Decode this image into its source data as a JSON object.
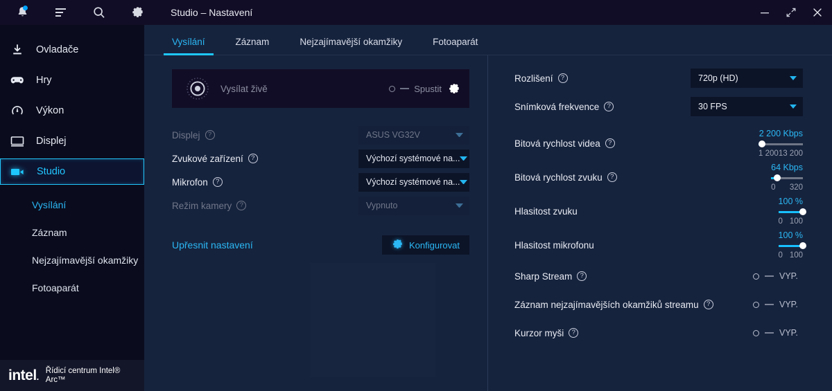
{
  "window": {
    "title": "Studio – Nastavení",
    "controls": {
      "minimize": "minimize-icon",
      "expand": "expand-icon",
      "close": "close-icon"
    }
  },
  "topbar_icons": [
    {
      "name": "notifications-bell-icon",
      "badge": true
    },
    {
      "name": "menu-lines-icon",
      "badge": false
    },
    {
      "name": "search-icon",
      "badge": false
    },
    {
      "name": "settings-gear-icon",
      "badge": false
    }
  ],
  "sidebar": {
    "items": [
      {
        "label": "Ovladače",
        "icon": "download-icon",
        "active": false
      },
      {
        "label": "Hry",
        "icon": "gamepad-icon",
        "active": false
      },
      {
        "label": "Výkon",
        "icon": "gauge-icon",
        "active": false
      },
      {
        "label": "Displej",
        "icon": "monitor-icon",
        "active": false
      },
      {
        "label": "Studio",
        "icon": "video-camera-icon",
        "active": true
      }
    ],
    "subitems": [
      {
        "label": "Vysílání",
        "selected": true
      },
      {
        "label": "Záznam",
        "selected": false
      },
      {
        "label": "Nejzajímavější okamžiky",
        "selected": false
      },
      {
        "label": "Fotoaparát",
        "selected": false
      }
    ],
    "brand": {
      "logo": "intel",
      "logo_dot": ".",
      "line1": "Řídicí centrum Intel®",
      "line2": "Arc™"
    }
  },
  "tabs": [
    {
      "label": "Vysílání",
      "active": true
    },
    {
      "label": "Záznam",
      "active": false
    },
    {
      "label": "Nejzajímavější okamžiky",
      "active": false
    },
    {
      "label": "Fotoaparát",
      "active": false
    }
  ],
  "left_pane": {
    "live_card": {
      "icon": "broadcast-live-icon",
      "label": "Vysílat živě",
      "toggle_state": "Spustit",
      "gear_icon": "gear-icon"
    },
    "rows": [
      {
        "label": "Displej",
        "help": true,
        "value": "ASUS VG32V",
        "disabled": true
      },
      {
        "label": "Zvukové zařízení",
        "help": true,
        "value": "Výchozí systémové na...",
        "disabled": false
      },
      {
        "label": "Mikrofon",
        "help": true,
        "value": "Výchozí systémové na...",
        "disabled": false
      },
      {
        "label": "Režim kamery",
        "help": true,
        "value": "Vypnuto",
        "disabled": true
      }
    ],
    "advanced": {
      "link": "Upřesnit nastavení",
      "button": "Konfigurovat",
      "button_icon": "gear-icon"
    }
  },
  "right_pane": {
    "selects": [
      {
        "label": "Rozlišení",
        "help": true,
        "value": "720p (HD)"
      },
      {
        "label": "Snímková frekvence",
        "help": true,
        "value": "30 FPS"
      }
    ],
    "sliders": [
      {
        "label": "Bitová rychlost videa",
        "help": true,
        "value_text": "2 200 Kbps",
        "min_text": "1 200",
        "max_text": "13 200",
        "percent": 8
      },
      {
        "label": "Bitová rychlost zvuku",
        "help": true,
        "value_text": "64 Kbps",
        "min_text": "0",
        "max_text": "320",
        "percent": 20
      },
      {
        "label": "Hlasitost zvuku",
        "help": false,
        "value_text": "100 %",
        "min_text": "0",
        "max_text": "100",
        "percent": 100
      },
      {
        "label": "Hlasitost mikrofonu",
        "help": false,
        "value_text": "100 %",
        "min_text": "0",
        "max_text": "100",
        "percent": 100
      }
    ],
    "toggles": [
      {
        "label": "Sharp Stream",
        "help": true,
        "state": "VYP."
      },
      {
        "label": "Záznam nejzajímavějších okamžiků streamu",
        "help": true,
        "state": "VYP."
      },
      {
        "label": "Kurzor myši",
        "help": true,
        "state": "VYP."
      }
    ]
  },
  "colors": {
    "accent": "#2bb8f5",
    "accent_bright": "#1ec8ff",
    "panel_bg": "#16233d",
    "sidebar_bg": "#0a0c1d",
    "titlebar_bg": "#120d26",
    "field_bg": "#0c1428",
    "text": "#e8ebf3",
    "muted": "#8b8fa3"
  }
}
